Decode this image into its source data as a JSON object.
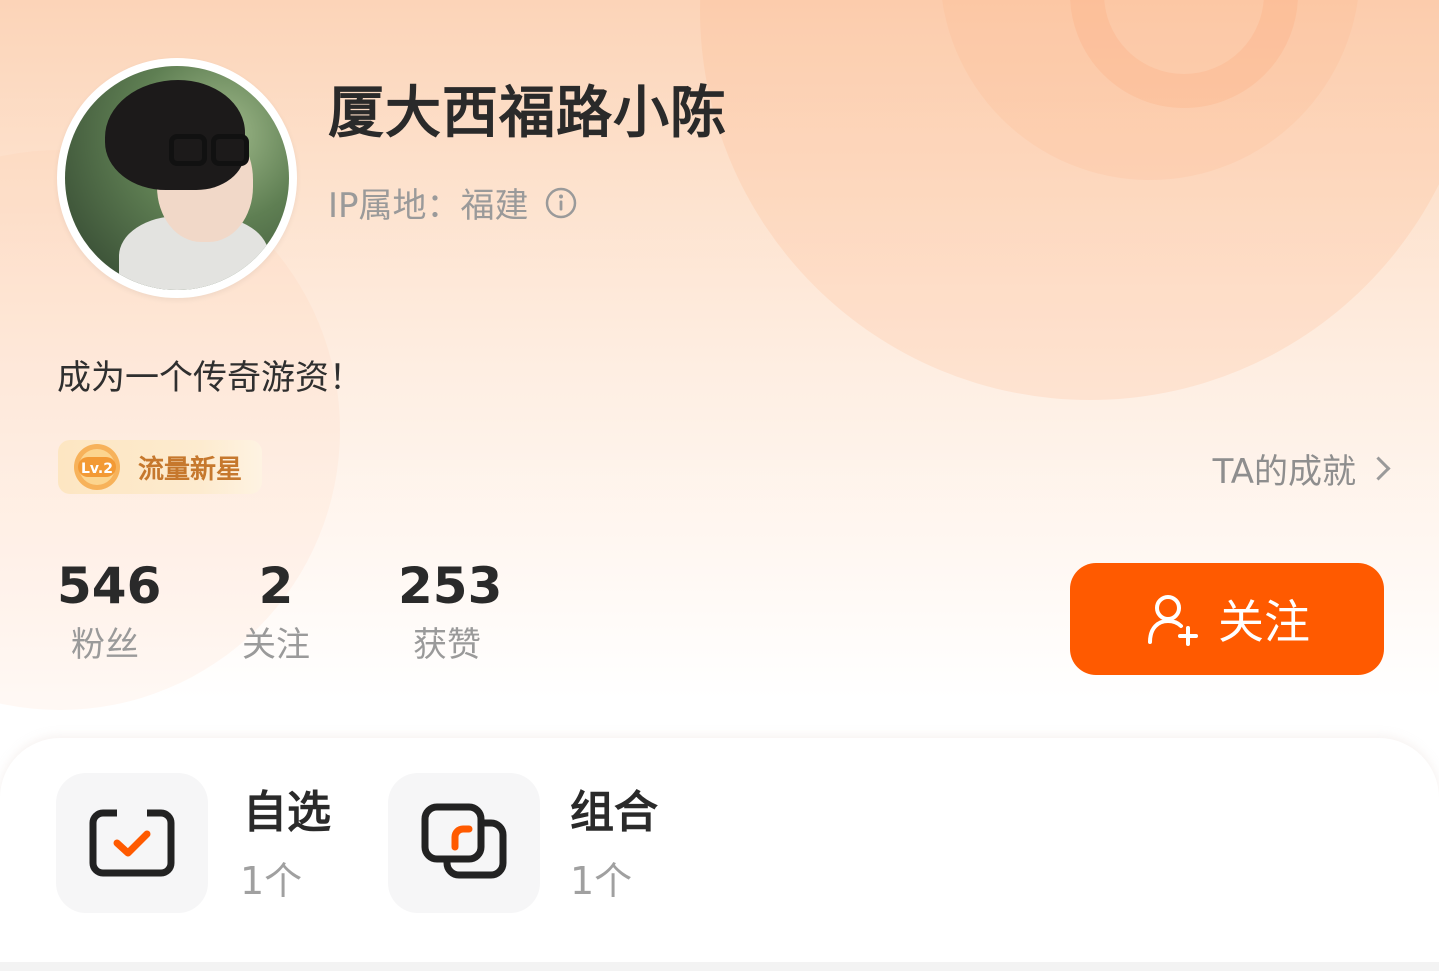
{
  "profile": {
    "nickname": "厦大西福路小陈",
    "ip_location": "IP属地：福建",
    "bio": "成为一个传奇游资！"
  },
  "badge": {
    "level": "Lv.2",
    "label": "流量新星"
  },
  "achievements": {
    "label": "TA的成就"
  },
  "stats": [
    {
      "value": "546",
      "label": "粉丝"
    },
    {
      "value": "2",
      "label": "关注"
    },
    {
      "value": "253",
      "label": "获赞"
    }
  ],
  "follow_button": {
    "label": "关注"
  },
  "shortcuts": [
    {
      "title": "自选",
      "count": "1个",
      "icon": "checkbox-icon"
    },
    {
      "title": "组合",
      "count": "1个",
      "icon": "portfolio-icon"
    }
  ],
  "colors": {
    "accent": "#ff5a00",
    "badge_text": "#c6782d"
  }
}
